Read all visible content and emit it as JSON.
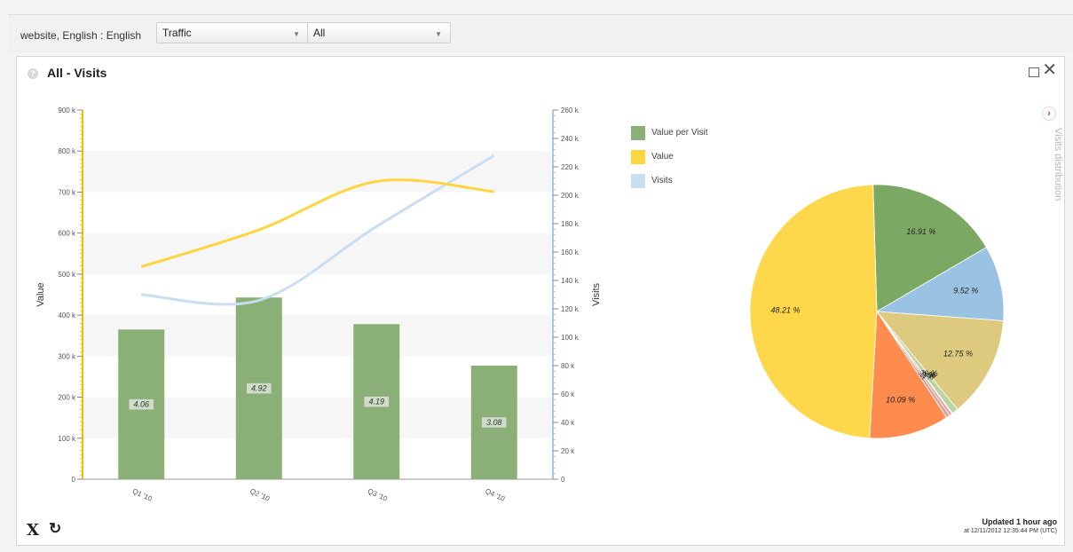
{
  "toolbar": {
    "context": "website, English : English",
    "selects": [
      {
        "value": "Traffic"
      },
      {
        "value": "All"
      }
    ]
  },
  "panel": {
    "help_icon": "?",
    "title": "All - Visits",
    "maximize_icon": "maximize-icon",
    "close_icon": "✕"
  },
  "legend": [
    {
      "label": "Value per Visit",
      "color": "#8ab077"
    },
    {
      "label": "Value",
      "color": "#fed53e"
    },
    {
      "label": "Visits",
      "color": "#c9def0"
    }
  ],
  "side": {
    "toggle_icon": "›",
    "distribution_label": "Visits distribution"
  },
  "footer": {
    "x_icon": "X",
    "refresh_icon": "↻",
    "updated": "Updated 1 hour ago",
    "timestamp": "at 12/11/2012 12:35:44 PM (UTC)"
  },
  "chart_data": [
    {
      "type": "bar",
      "categories": [
        "Q1 '10",
        "Q2 '10",
        "Q3 '10",
        "Q4 '10"
      ],
      "ylabel": "Value",
      "y2label": "Visits",
      "ylim": [
        0,
        900000
      ],
      "y2lim": [
        0,
        260000
      ],
      "yticks": [
        "0",
        "100 k",
        "200 k",
        "300 k",
        "400 k",
        "500 k",
        "600 k",
        "700 k",
        "800 k",
        "900 k"
      ],
      "y2ticks": [
        "0",
        "20 k",
        "40 k",
        "60 k",
        "80 k",
        "100 k",
        "120 k",
        "140 k",
        "160 k",
        "180 k",
        "200 k",
        "220 k",
        "240 k",
        "260 k"
      ],
      "series": [
        {
          "name": "Value per Visit",
          "kind": "bar",
          "axis": "left",
          "color": "#8ab077",
          "values": [
            365000,
            443000,
            378000,
            277000
          ],
          "labels": [
            "4.06",
            "4.92",
            "4.19",
            "3.08"
          ]
        },
        {
          "name": "Value",
          "kind": "line",
          "axis": "left",
          "color": "#fed53e",
          "values": [
            518000,
            608000,
            726000,
            701000
          ]
        },
        {
          "name": "Visits",
          "kind": "line",
          "axis": "right",
          "color": "#c9def0",
          "values": [
            130000,
            126000,
            178000,
            228000
          ]
        }
      ],
      "grid": true,
      "legend": "right"
    },
    {
      "type": "pie",
      "title": "Visits distribution",
      "slices": [
        {
          "label": "16.91 %",
          "value": 16.91,
          "color": "#7ba862"
        },
        {
          "label": "9.52 %",
          "value": 9.52,
          "color": "#9ac3e3"
        },
        {
          "label": "12.75 %",
          "value": 12.75,
          "color": "#ddca7f"
        },
        {
          "label": "0.79 %",
          "value": 0.79,
          "color": "#b9d4a4"
        },
        {
          "label": "0.12 %",
          "value": 0.12,
          "color": "#c7d6ea"
        },
        {
          "label": "0.33 %",
          "value": 0.33,
          "color": "#e79a8e"
        },
        {
          "label": "0.46 %",
          "value": 0.46,
          "color": "#d9a2a2"
        },
        {
          "label": "10.09 %",
          "value": 10.09,
          "color": "#fe8c4f"
        },
        {
          "label": "48.21 %",
          "value": 48.21,
          "color": "#fed84a"
        }
      ]
    }
  ]
}
